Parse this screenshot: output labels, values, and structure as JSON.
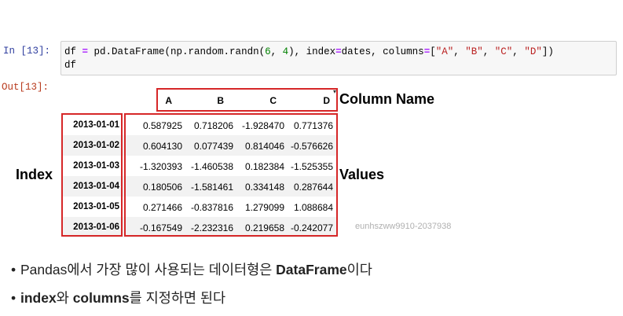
{
  "in_prompt": "In [13]:",
  "out_prompt": "Out[13]:",
  "code": {
    "line1_prefix": "df ",
    "line1_eq1": "=",
    "line1_call": " pd.DataFrame(np.random.randn(",
    "line1_n6": "6",
    "line1_comma": ", ",
    "line1_n4": "4",
    "line1_mid": "), index",
    "line1_eq2": "=",
    "line1_mid2": "dates, columns",
    "line1_eq3": "=",
    "line1_open": "[",
    "line1_sA": "\"A\"",
    "line1_c1": ", ",
    "line1_sB": "\"B\"",
    "line1_c2": ", ",
    "line1_sC": "\"C\"",
    "line1_c3": ", ",
    "line1_sD": "\"D\"",
    "line1_close": "])",
    "line2": "df"
  },
  "table": {
    "columns": [
      "A",
      "B",
      "C",
      "D"
    ],
    "rows": [
      {
        "index": "2013-01-01",
        "values": [
          "0.587925",
          "0.718206",
          "-1.928470",
          "0.771376"
        ]
      },
      {
        "index": "2013-01-02",
        "values": [
          "0.604130",
          "0.077439",
          "0.814046",
          "-0.576626"
        ]
      },
      {
        "index": "2013-01-03",
        "values": [
          "-1.320393",
          "-1.460538",
          "0.182384",
          "-1.525355"
        ]
      },
      {
        "index": "2013-01-04",
        "values": [
          "0.180506",
          "-1.581461",
          "0.334148",
          "0.287644"
        ]
      },
      {
        "index": "2013-01-05",
        "values": [
          "0.271466",
          "-0.837816",
          "1.279099",
          "1.088684"
        ]
      },
      {
        "index": "2013-01-06",
        "values": [
          "-0.167549",
          "-2.232316",
          "0.219658",
          "-0.242077"
        ]
      }
    ]
  },
  "annotations": {
    "column_name": "Column Name",
    "index": "Index",
    "values": "Values",
    "box_color": "#d62728"
  },
  "watermark": "eunhszww9910-2037938",
  "bullets": {
    "b1_pre": "Pandas에서 가장 많이 사용되는 데이터형은 ",
    "b1_bold": "DataFrame",
    "b1_post": "이다",
    "b2_bold1": "index",
    "b2_mid": "와 ",
    "b2_bold2": "columns",
    "b2_post": "를 지정하면 된다"
  }
}
